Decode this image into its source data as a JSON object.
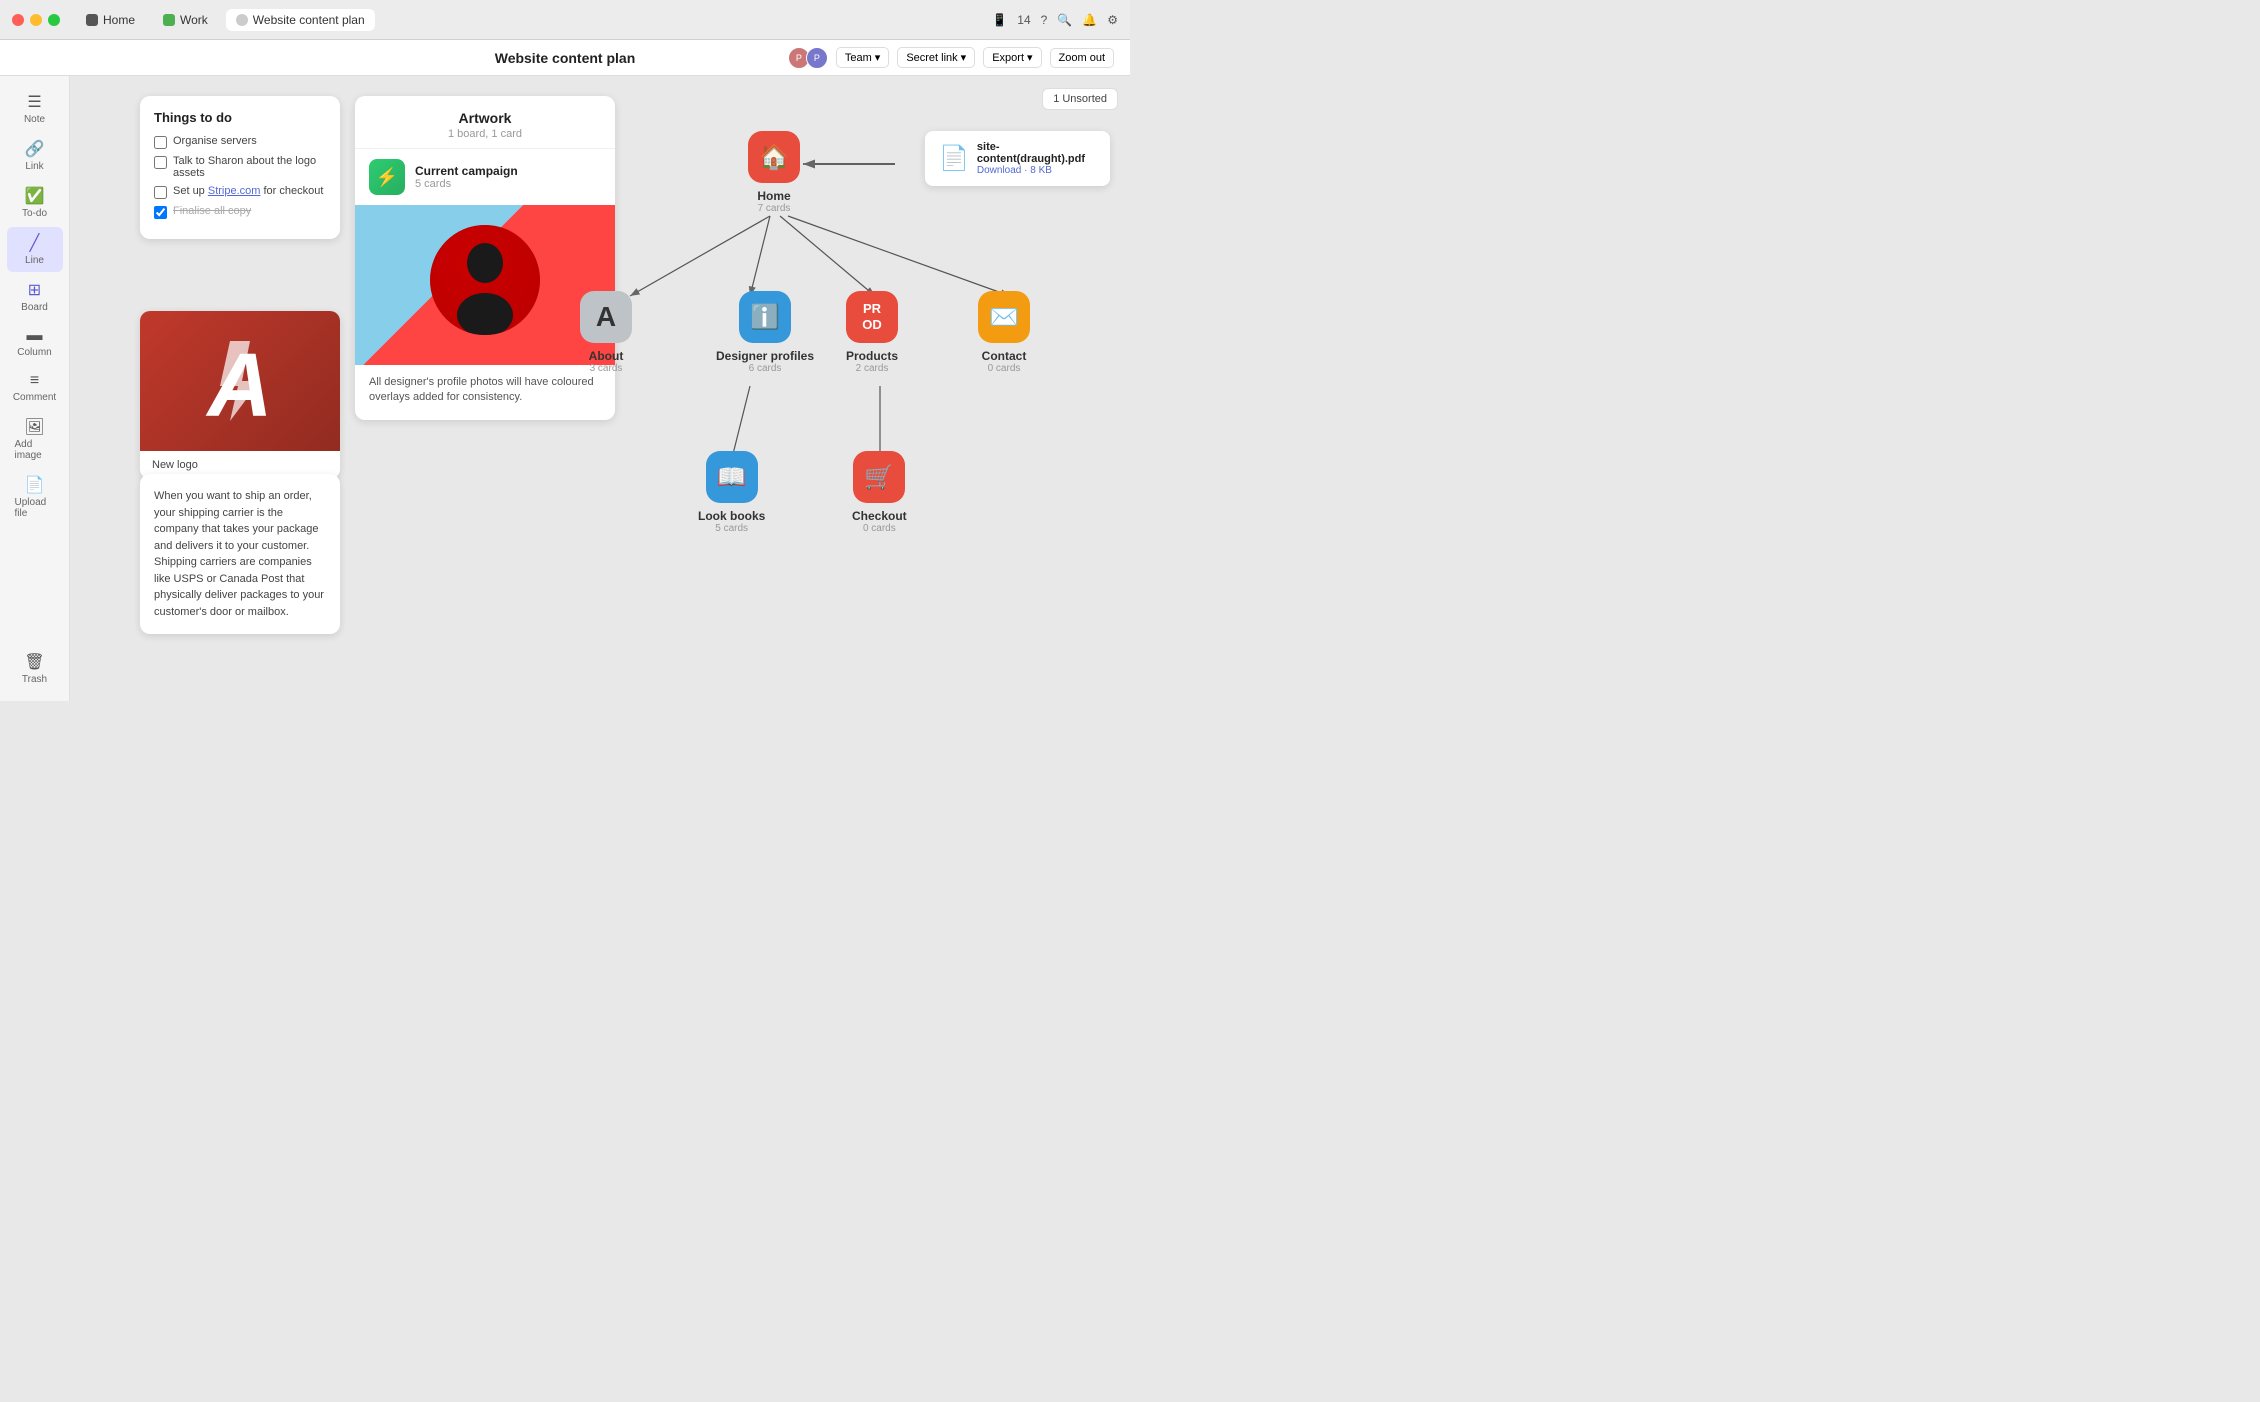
{
  "titlebar": {
    "tabs": [
      {
        "id": "home",
        "label": "Home",
        "active": false
      },
      {
        "id": "work",
        "label": "Work",
        "active": false
      },
      {
        "id": "website",
        "label": "Website content plan",
        "active": true
      }
    ],
    "right": {
      "device_icon": "📱",
      "device_count": "14",
      "help_icon": "?",
      "search_icon": "🔍",
      "bell_icon": "🔔",
      "settings_icon": "⚙"
    }
  },
  "toolbar": {
    "title": "Website content plan",
    "team_label": "Team",
    "secret_link_label": "Secret link",
    "export_label": "Export",
    "zoom_out_label": "Zoom out"
  },
  "sidebar": {
    "items": [
      {
        "id": "note",
        "icon": "☰",
        "label": "Note"
      },
      {
        "id": "link",
        "icon": "🔗",
        "label": "Link"
      },
      {
        "id": "todo",
        "icon": "☑",
        "label": "To-do"
      },
      {
        "id": "line",
        "icon": "╱",
        "label": "Line",
        "active": true
      },
      {
        "id": "board",
        "icon": "⊞",
        "label": "Board"
      },
      {
        "id": "column",
        "icon": "▬",
        "label": "Column"
      },
      {
        "id": "comment",
        "icon": "≡",
        "label": "Comment"
      },
      {
        "id": "add_image",
        "icon": "🖼",
        "label": "Add image"
      },
      {
        "id": "upload",
        "icon": "📄",
        "label": "Upload file"
      }
    ],
    "bottom": [
      {
        "id": "trash",
        "icon": "🗑",
        "label": "Trash"
      }
    ]
  },
  "unsorted": {
    "label": "1 Unsorted"
  },
  "todo_card": {
    "title": "Things to do",
    "items": [
      {
        "text": "Organise servers",
        "checked": false
      },
      {
        "text": "Talk to Sharon about the logo assets",
        "checked": false
      },
      {
        "text1": "Set up ",
        "link": "Stripe.com",
        "text2": " for checkout",
        "checked": false
      },
      {
        "text": "Finalise all copy",
        "checked": true
      }
    ]
  },
  "artwork_card": {
    "title": "Artwork",
    "subtitle": "1 board, 1 card",
    "campaign": {
      "name": "Current campaign",
      "count": "5 cards"
    },
    "caption": "All designer's profile photos will have coloured overlays added for consistency."
  },
  "logo_card": {
    "label": "New logo"
  },
  "text_card": {
    "content": "When you want to ship an order, your shipping carrier is the company that takes your package and delivers it to your customer. Shipping carriers are companies like USPS or Canada Post that physically deliver packages to your customer's door or mailbox."
  },
  "pdf_card": {
    "filename": "site-content(draught).pdf",
    "link_text": "Download",
    "size": "8 KB"
  },
  "diagram": {
    "nodes": [
      {
        "id": "home",
        "label": "Home",
        "count": "7 cards",
        "icon": "🏠",
        "color": "#e74c3c"
      },
      {
        "id": "about",
        "label": "About",
        "count": "3 cards",
        "icon": "A",
        "color": "#bdc3c7"
      },
      {
        "id": "designer",
        "label": "Designer profiles",
        "count": "6 cards",
        "icon": "ℹ",
        "color": "#3498db"
      },
      {
        "id": "products",
        "label": "Products",
        "count": "2 cards",
        "icon": "PROD",
        "color": "#e74c3c"
      },
      {
        "id": "contact",
        "label": "Contact",
        "count": "0 cards",
        "icon": "✉",
        "color": "#f39c12"
      },
      {
        "id": "lookbooks",
        "label": "Look books",
        "count": "5 cards",
        "icon": "📖",
        "color": "#3498db"
      },
      {
        "id": "checkout",
        "label": "Checkout",
        "count": "0 cards",
        "icon": "🛒",
        "color": "#e74c3c"
      }
    ]
  }
}
